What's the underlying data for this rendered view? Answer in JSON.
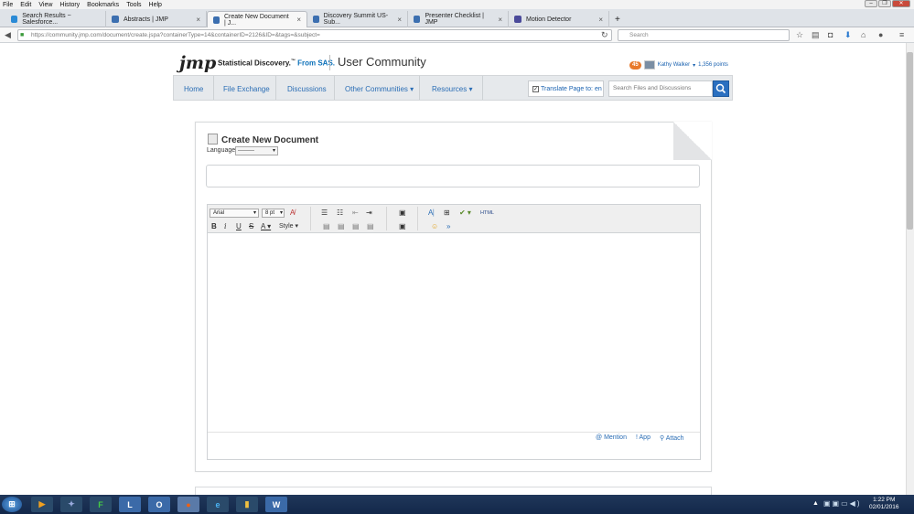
{
  "menu": {
    "items": [
      "File",
      "Edit",
      "View",
      "History",
      "Bookmarks",
      "Tools",
      "Help"
    ]
  },
  "tabs": [
    {
      "title": "Search Results ~ Salesforce...",
      "color": "#2a8ad6"
    },
    {
      "title": "Abstracts | JMP",
      "color": "#3c6fb0"
    },
    {
      "title": "Create New Document | J...",
      "color": "#3c6fb0",
      "active": true
    },
    {
      "title": "Discovery Summit US- Sub...",
      "color": "#3c6fb0"
    },
    {
      "title": "Presenter Checklist | JMP",
      "color": "#3c6fb0"
    },
    {
      "title": "Motion Detector",
      "color": "#4a4a9a"
    }
  ],
  "browser": {
    "url": "https://community.jmp.com/document/create.jspa?containerType=14&containerID=2126&ID=&tags=&subject=",
    "search_placeholder": "Search"
  },
  "site": {
    "logo": "jmp",
    "tagline": "Statistical Discovery.",
    "tagline_tm": "™",
    "tagline_brand": "From SAS.",
    "community": "User Community",
    "points_badge": "45",
    "user": "Kathy Walker",
    "points": "1,356 points"
  },
  "nav": {
    "home": "Home",
    "file_exchange": "File Exchange",
    "discussions": "Discussions",
    "other": "Other Communities",
    "resources": "Resources",
    "translate": "Translate Page to:",
    "translate_lang": "en",
    "search_placeholder": "Search Files and Discussions"
  },
  "document": {
    "title": "Create New Document",
    "language_label": "Language",
    "language_value": "---------"
  },
  "editor": {
    "font": "Arial",
    "size": "8 pt",
    "style": "Style",
    "html": "HTML",
    "mention": "Mention",
    "app": "! App",
    "attach": "Attach"
  },
  "taskbar": {
    "time": "1:22 PM",
    "date": "02/01/2016"
  }
}
